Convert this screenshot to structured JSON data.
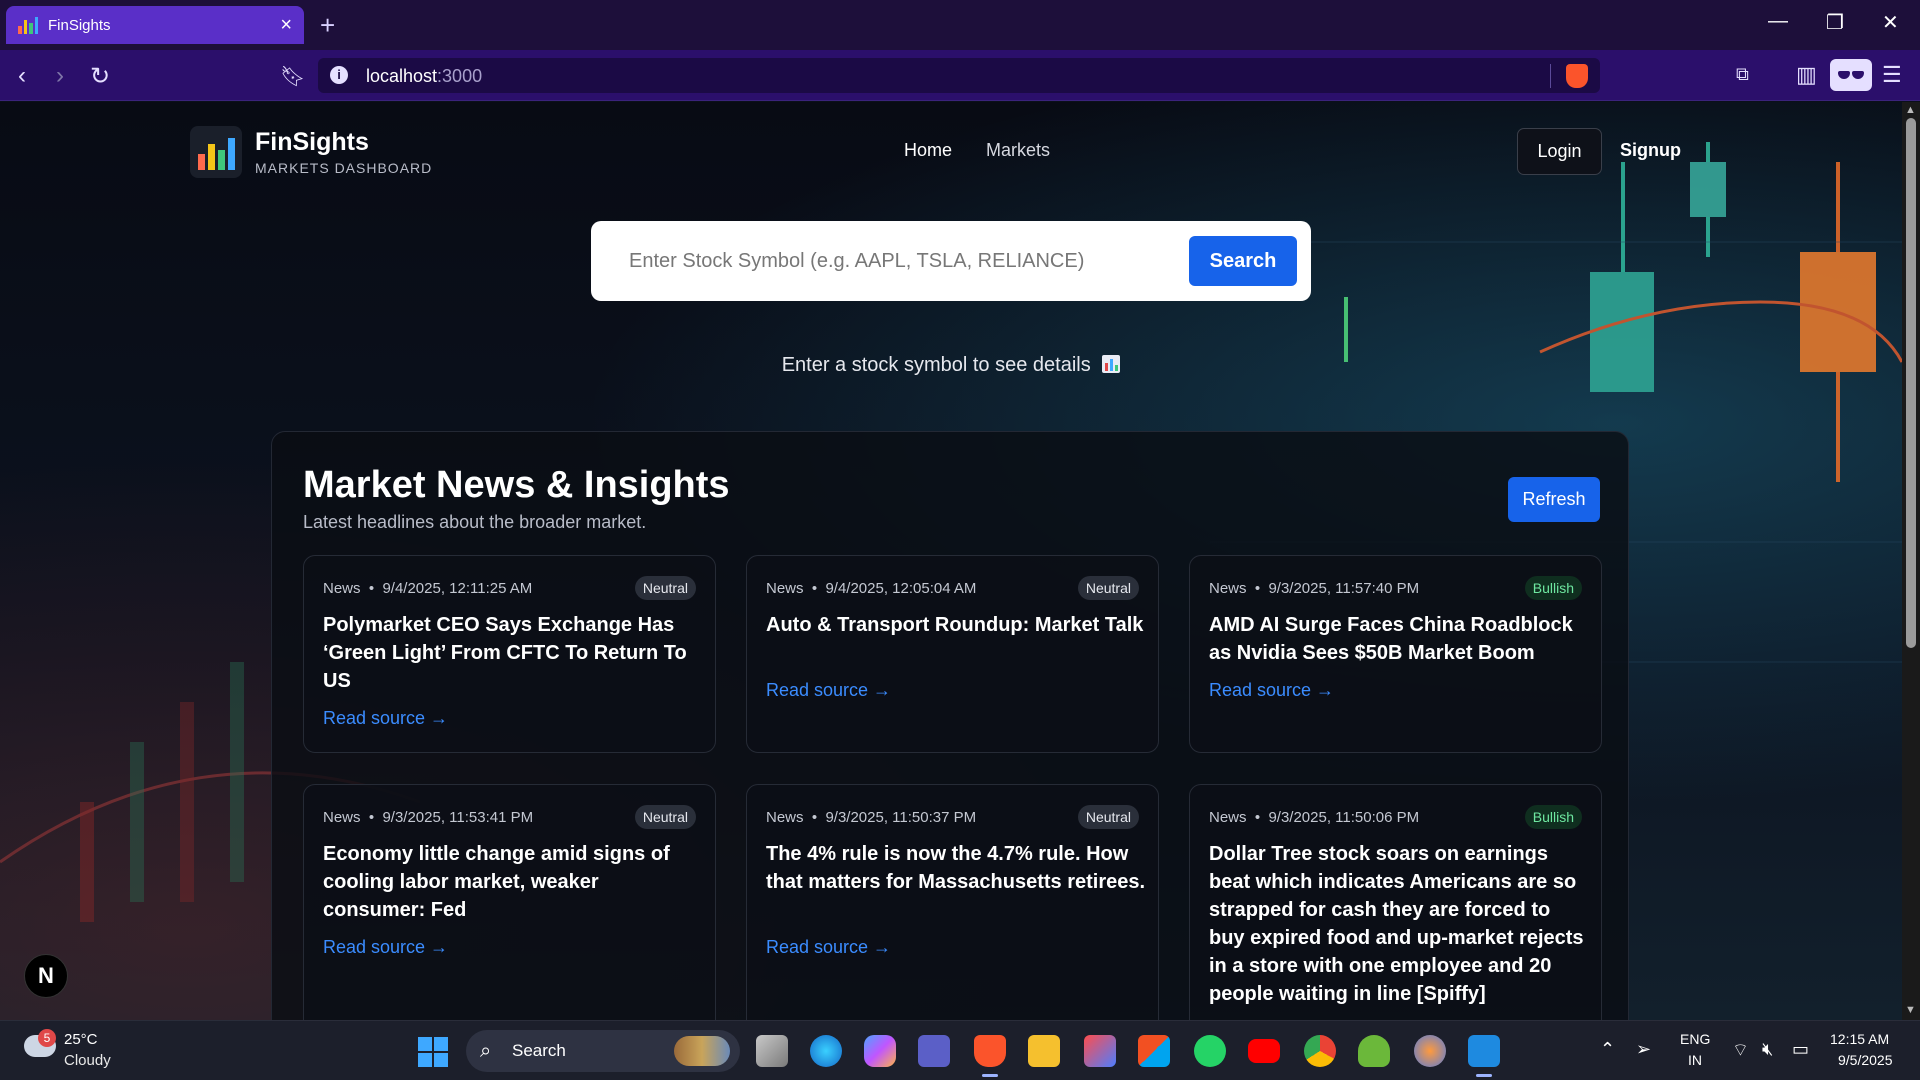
{
  "browser": {
    "tab_title": "FinSights",
    "url_host": "localhost",
    "url_port": ":3000"
  },
  "header": {
    "brand_name": "FinSights",
    "brand_sub": "MARKETS DASHBOARD",
    "nav": [
      "Home",
      "Markets"
    ],
    "login": "Login",
    "signup": "Signup"
  },
  "search": {
    "placeholder": "Enter Stock Symbol (e.g. AAPL, TSLA, RELIANCE)",
    "button": "Search",
    "hint": "Enter a stock symbol to see details"
  },
  "news": {
    "title": "Market News & Insights",
    "subtitle": "Latest headlines about the broader market.",
    "refresh": "Refresh",
    "read_label": "Read source →",
    "items": [
      {
        "source": "News",
        "time": "9/4/2025, 12:11:25 AM",
        "sentiment": "Neutral",
        "headline": "Polymarket CEO Says Exchange Has ‘Green Light’ From CFTC To Return To US"
      },
      {
        "source": "News",
        "time": "9/4/2025, 12:05:04 AM",
        "sentiment": "Neutral",
        "headline": "Auto & Transport Roundup: Market Talk"
      },
      {
        "source": "News",
        "time": "9/3/2025, 11:57:40 PM",
        "sentiment": "Bullish",
        "headline": "AMD AI Surge Faces China Roadblock as Nvidia Sees $50B Market Boom"
      },
      {
        "source": "News",
        "time": "9/3/2025, 11:53:41 PM",
        "sentiment": "Neutral",
        "headline": "Economy little change amid signs of cooling labor market, weaker consumer: Fed"
      },
      {
        "source": "News",
        "time": "9/3/2025, 11:50:37 PM",
        "sentiment": "Neutral",
        "headline": "The 4% rule is now the 4.7% rule. How that matters for Massachusetts retirees."
      },
      {
        "source": "News",
        "time": "9/3/2025, 11:50:06 PM",
        "sentiment": "Bullish",
        "headline": "Dollar Tree stock soars on earnings beat which indicates Americans are so strapped for cash they are forced to buy expired food and up-market rejects in a store with one employee and 20 people waiting in line [Spiffy]"
      }
    ]
  },
  "dev_badge": "N",
  "taskbar": {
    "weather_temp": "25°C",
    "weather_cond": "Cloudy",
    "weather_alerts": "5",
    "search_label": "Search",
    "lang_top": "ENG",
    "lang_bottom": "IN",
    "time": "12:15 AM",
    "date": "9/5/2025",
    "apps": [
      "task-view",
      "edge",
      "copilot",
      "teams",
      "brave",
      "file-explorer",
      "affinity",
      "store",
      "whatsapp",
      "youtube",
      "chrome",
      "figure-app",
      "browser-globe",
      "vscode"
    ]
  },
  "colors": {
    "accent_blue": "#1763ea",
    "link_blue": "#3b8cff",
    "bullish_green": "#6ee7a0",
    "browser_purple": "#2b0f6b"
  }
}
